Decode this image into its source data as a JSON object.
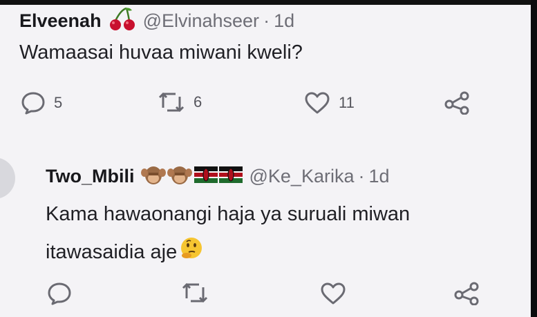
{
  "tweets": [
    {
      "display_name": "Elveenah",
      "handle": "@Elvinahseer",
      "separator": "·",
      "time": "1d",
      "text": "Wamaasai huvaa miwani kweli?",
      "name_emoji": "cherries-icon",
      "actions": {
        "reply_count": "5",
        "retweet_count": "6",
        "like_count": "11"
      }
    },
    {
      "display_name": "Two_Mbili",
      "handle": "@Ke_Karika",
      "separator": "·",
      "time": "1d",
      "text_line1": "Kama hawaonangi haja ya suruali miwan",
      "text_line2": "itawasaidia aje",
      "name_emojis": [
        "monkey-icon",
        "monkey-icon",
        "kenya-flag-icon",
        "kenya-flag-icon"
      ],
      "trailing_emoji": "thinking-face-icon",
      "actions": {
        "reply_count": "",
        "retweet_count": "",
        "like_count": ""
      }
    }
  ],
  "colors": {
    "background": "#f4f3f6",
    "text": "#1f1f24",
    "muted": "#6e6e76",
    "icon": "#6a6a72"
  }
}
